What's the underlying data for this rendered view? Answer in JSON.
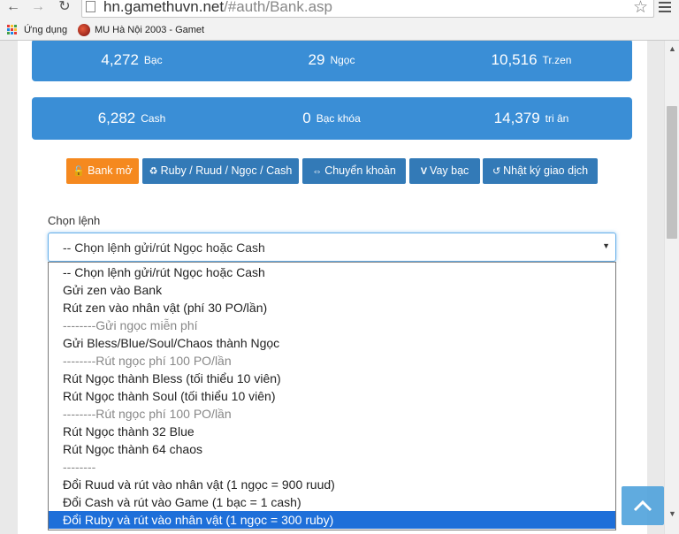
{
  "browser": {
    "url_host": "hn.gamethuvn.net",
    "url_path": "/#auth/Bank.asp",
    "bookmarks": [
      {
        "label": "Ứng dụng"
      },
      {
        "label": "MU Hà Nội 2003 - Gamet"
      }
    ]
  },
  "stats_row1": [
    {
      "value": "4,272",
      "unit": "Bạc"
    },
    {
      "value": "29",
      "unit": "Ngọc"
    },
    {
      "value": "10,516",
      "unit": "Tr.zen"
    }
  ],
  "stats_row2": [
    {
      "value": "6,282",
      "unit": "Cash"
    },
    {
      "value": "0",
      "unit": "Bạc khóa"
    },
    {
      "value": "14,379",
      "unit": "tri ân"
    }
  ],
  "actions": [
    {
      "label": "Bank mở",
      "icon": "unlock-icon"
    },
    {
      "label": "Ruby / Ruud / Ngọc / Cash",
      "icon": "recycle-icon"
    },
    {
      "label": "Chuyển khoản",
      "icon": "transfer-icon"
    },
    {
      "label": "Vay bạc",
      "icon": "vimeo-icon"
    },
    {
      "label": "Nhật ký giao dịch",
      "icon": "history-icon"
    }
  ],
  "command": {
    "label": "Chọn lệnh",
    "selected_value": "-- Chọn lệnh gửi/rút Ngọc hoặc Cash",
    "options": [
      {
        "text": "-- Chọn lệnh gửi/rút Ngọc hoặc Cash",
        "state": "normal"
      },
      {
        "text": "Gửi zen vào Bank",
        "state": "normal"
      },
      {
        "text": "Rút zen vào nhân vật (phí 30 PO/lần)",
        "state": "normal"
      },
      {
        "text": "--------Gửi ngọc miễn phí",
        "state": "disabled"
      },
      {
        "text": "Gửi Bless/Blue/Soul/Chaos thành Ngọc",
        "state": "normal"
      },
      {
        "text": "--------Rút ngọc phí 100 PO/lần",
        "state": "disabled"
      },
      {
        "text": "Rút Ngọc thành Bless (tối thiểu 10 viên)",
        "state": "normal"
      },
      {
        "text": "Rút Ngọc thành Soul (tối thiểu 10 viên)",
        "state": "normal"
      },
      {
        "text": "--------Rút ngọc phí 100 PO/lần",
        "state": "disabled"
      },
      {
        "text": "Rút Ngọc thành 32 Blue",
        "state": "normal"
      },
      {
        "text": "Rút Ngọc thành 64 chaos",
        "state": "normal"
      },
      {
        "text": "--------",
        "state": "disabled"
      },
      {
        "text": "Đổi Ruud và rút vào nhân vật (1 ngọc = 900 ruud)",
        "state": "normal"
      },
      {
        "text": "Đổi Cash và rút vào Game (1 bạc = 1 cash)",
        "state": "normal"
      },
      {
        "text": "Đổi Ruby và rút vào nhân vật (1 ngọc = 300 ruby)",
        "state": "highlighted"
      }
    ]
  },
  "colors": {
    "stat_bg": "#3a8ed6",
    "bank_button": "#f5891f",
    "action_button": "#337ab7",
    "highlight": "#1e6fd9"
  }
}
